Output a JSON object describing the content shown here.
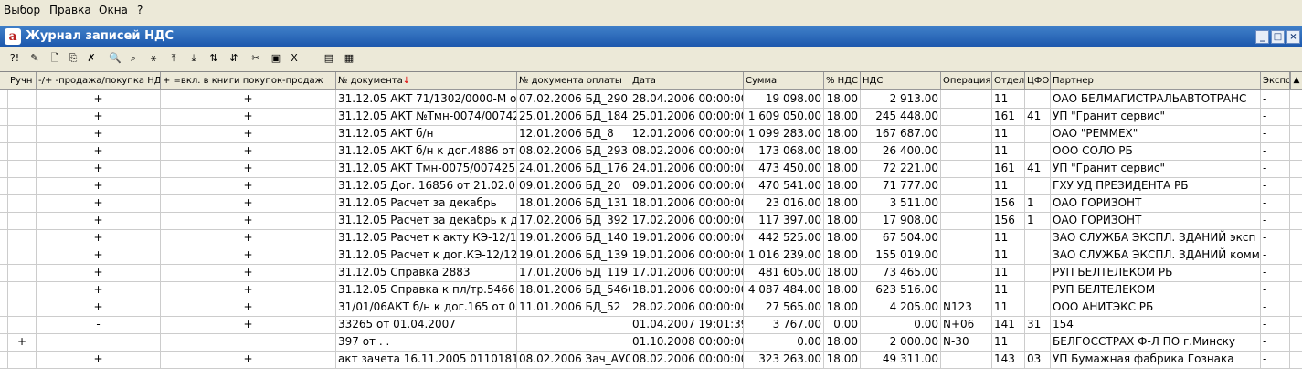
{
  "menu": [
    "Выбор",
    "Правка",
    "Окна",
    "?"
  ],
  "window": {
    "title": "Журнал записей НДС",
    "app_icon": "a",
    "minimize": "_",
    "maximize": "□",
    "close": "×"
  },
  "toolbar": [
    {
      "name": "help-icon",
      "glyph": "?!"
    },
    {
      "name": "edit-icon",
      "glyph": "✎"
    },
    {
      "name": "new-doc-icon",
      "glyph": "🗋"
    },
    {
      "name": "copy-icon",
      "glyph": "⎘"
    },
    {
      "name": "delete-doc-icon",
      "glyph": "✗"
    },
    {
      "name": "search-icon",
      "glyph": "🔍"
    },
    {
      "name": "find-doc-icon",
      "glyph": "⌕"
    },
    {
      "name": "filter-icon",
      "glyph": "⚹"
    },
    {
      "name": "move-up-icon",
      "glyph": "⤒"
    },
    {
      "name": "move-down-icon",
      "glyph": "⤓"
    },
    {
      "name": "sort-az-icon",
      "glyph": "⇅"
    },
    {
      "name": "sort-icon",
      "glyph": "⇵"
    },
    {
      "name": "cut-icon",
      "glyph": "✂"
    },
    {
      "name": "view-icon",
      "glyph": "▣"
    },
    {
      "name": "excel-icon",
      "glyph": "X"
    },
    {
      "name": "report-icon",
      "glyph": "▤"
    },
    {
      "name": "journal-icon",
      "glyph": "▦"
    }
  ],
  "columns": [
    {
      "id": "manual",
      "label": "Ручн"
    },
    {
      "id": "sale",
      "label": "-/+ -продажа/покупка НДС"
    },
    {
      "id": "book",
      "label": "+ =вкл. в книги покупок-продаж"
    },
    {
      "id": "docnum",
      "label": "№ документа"
    },
    {
      "id": "paydoc",
      "label": "№ документа оплаты"
    },
    {
      "id": "date",
      "label": "Дата"
    },
    {
      "id": "sum",
      "label": "Сумма"
    },
    {
      "id": "pct",
      "label": "% НДС"
    },
    {
      "id": "vat",
      "label": "НДС"
    },
    {
      "id": "op",
      "label": "Операция"
    },
    {
      "id": "dept",
      "label": "Отдел"
    },
    {
      "id": "cfo",
      "label": "ЦФО"
    },
    {
      "id": "partner",
      "label": "Партнер"
    },
    {
      "id": "export",
      "label": "Экспо"
    }
  ],
  "sort_indicator": "↓",
  "rows": [
    {
      "manual": "",
      "sale": "+",
      "book": "+",
      "docnum": "31.12.05 АКТ 71/1302/0000-М от",
      "paydoc": "07.02.2006 БД_290",
      "date": "28.04.2006 00:00:00",
      "sum": "19 098.00",
      "pct": "18.00",
      "vat": "2 913.00",
      "op": "",
      "dept": "11",
      "cfo": "",
      "partner": "ОАО БЕЛМАГИСТРАЛЬАВТОТРАНС",
      "export": "-"
    },
    {
      "manual": "",
      "sale": "+",
      "book": "+",
      "docnum": "31.12.05 АКТ №Тмн-0074/00742",
      "paydoc": "25.01.2006 БД_184",
      "date": "25.01.2006 00:00:00",
      "sum": "1 609 050.00",
      "pct": "18.00",
      "vat": "245 448.00",
      "op": "",
      "dept": "161",
      "cfo": "41",
      "partner": "УП \"Гранит сервис\"",
      "export": "-"
    },
    {
      "manual": "",
      "sale": "+",
      "book": "+",
      "docnum": "31.12.05 АКТ б/н",
      "paydoc": "12.01.2006 БД_8",
      "date": "12.01.2006 00:00:00",
      "sum": "1 099 283.00",
      "pct": "18.00",
      "vat": "167 687.00",
      "op": "",
      "dept": "11",
      "cfo": "",
      "partner": "ОАО \"РЕММЕХ\"",
      "export": "-"
    },
    {
      "manual": "",
      "sale": "+",
      "book": "+",
      "docnum": "31.12.05 АКТ б/н к дог.4886 от",
      "paydoc": "08.02.2006 БД_293",
      "date": "08.02.2006 00:00:00",
      "sum": "173 068.00",
      "pct": "18.00",
      "vat": "26 400.00",
      "op": "",
      "dept": "11",
      "cfo": "",
      "partner": "ООО СОЛО РБ",
      "export": "-"
    },
    {
      "manual": "",
      "sale": "+",
      "book": "+",
      "docnum": "31.12.05 АКТ Тмн-0075/0074253",
      "paydoc": "24.01.2006 БД_176",
      "date": "24.01.2006 00:00:00",
      "sum": "473 450.00",
      "pct": "18.00",
      "vat": "72 221.00",
      "op": "",
      "dept": "161",
      "cfo": "41",
      "partner": "УП \"Гранит сервис\"",
      "export": "-"
    },
    {
      "manual": "",
      "sale": "+",
      "book": "+",
      "docnum": "31.12.05 Дог. 16856 от 21.02.0",
      "paydoc": "09.01.2006 БД_20",
      "date": "09.01.2006 00:00:00",
      "sum": "470 541.00",
      "pct": "18.00",
      "vat": "71 777.00",
      "op": "",
      "dept": "11",
      "cfo": "",
      "partner": "ГХУ УД ПРЕЗИДЕНТА РБ",
      "export": "-"
    },
    {
      "manual": "",
      "sale": "+",
      "book": "+",
      "docnum": "31.12.05 Расчет за декабрь",
      "paydoc": "18.01.2006 БД_131",
      "date": "18.01.2006 00:00:00",
      "sum": "23 016.00",
      "pct": "18.00",
      "vat": "3 511.00",
      "op": "",
      "dept": "156",
      "cfo": "1",
      "partner": "ОАО ГОРИЗОНТ",
      "export": "-"
    },
    {
      "manual": "",
      "sale": "+",
      "book": "+",
      "docnum": "31.12.05 Расчет за декабрь к д",
      "paydoc": "17.02.2006 БД_392",
      "date": "17.02.2006 00:00:00",
      "sum": "117 397.00",
      "pct": "18.00",
      "vat": "17 908.00",
      "op": "",
      "dept": "156",
      "cfo": "1",
      "partner": "ОАО ГОРИЗОНТ",
      "export": "-"
    },
    {
      "manual": "",
      "sale": "+",
      "book": "+",
      "docnum": "31.12.05 Расчет к акту КЭ-12/1",
      "paydoc": "19.01.2006 БД_140",
      "date": "19.01.2006 00:00:00",
      "sum": "442 525.00",
      "pct": "18.00",
      "vat": "67 504.00",
      "op": "",
      "dept": "11",
      "cfo": "",
      "partner": "ЗАО СЛУЖБА ЭКСПЛ. ЗДАНИЙ эксп",
      "export": "-"
    },
    {
      "manual": "",
      "sale": "+",
      "book": "+",
      "docnum": "31.12.05 Расчет к дог.КЭ-12/12",
      "paydoc": "19.01.2006 БД_139",
      "date": "19.01.2006 00:00:00",
      "sum": "1 016 239.00",
      "pct": "18.00",
      "vat": "155 019.00",
      "op": "",
      "dept": "11",
      "cfo": "",
      "partner": "ЗАО СЛУЖБА ЭКСПЛ. ЗДАНИЙ комм",
      "export": "-"
    },
    {
      "manual": "",
      "sale": "+",
      "book": "+",
      "docnum": "31.12.05 Справка 2883",
      "paydoc": "17.01.2006 БД_119",
      "date": "17.01.2006 00:00:00",
      "sum": "481 605.00",
      "pct": "18.00",
      "vat": "73 465.00",
      "op": "",
      "dept": "11",
      "cfo": "",
      "partner": "РУП БЕЛТЕЛЕКОМ РБ",
      "export": "-"
    },
    {
      "manual": "",
      "sale": "+",
      "book": "+",
      "docnum": "31.12.05 Справка к пл/тр.5466",
      "paydoc": "18.01.2006 БД_5466",
      "date": "18.01.2006 00:00:00",
      "sum": "4 087 484.00",
      "pct": "18.00",
      "vat": "623 516.00",
      "op": "",
      "dept": "11",
      "cfo": "",
      "partner": "РУП БЕЛТЕЛЕКОМ",
      "export": "-"
    },
    {
      "manual": "",
      "sale": "+",
      "book": "+",
      "docnum": "31/01/06АКТ б/н к дог.165 от 0",
      "paydoc": "11.01.2006 БД_52",
      "date": "28.02.2006 00:00:00",
      "sum": "27 565.00",
      "pct": "18.00",
      "vat": "4 205.00",
      "op": "N123",
      "dept": "11",
      "cfo": "",
      "partner": "ООО АНИТЭКС РБ",
      "export": "-"
    },
    {
      "manual": "",
      "sale": "-",
      "book": "+",
      "docnum": "33265 от 01.04.2007",
      "paydoc": "",
      "date": "01.04.2007 19:01:39",
      "sum": "3 767.00",
      "pct": "0.00",
      "vat": "0.00",
      "op": "N+06",
      "dept": "141",
      "cfo": "31",
      "partner": "154",
      "export": "-"
    },
    {
      "manual": "+",
      "sale": "",
      "book": "",
      "docnum": "397 от   .  .",
      "paydoc": "",
      "date": "01.10.2008 00:00:00",
      "sum": "0.00",
      "pct": "18.00",
      "vat": "2 000.00",
      "op": "N-30",
      "dept": "11",
      "cfo": "",
      "partner": "БЕЛГОССТРАХ Ф-Л ПО г.Минску",
      "export": "-"
    },
    {
      "manual": "",
      "sale": "+",
      "book": "+",
      "docnum": "акт зачета 16.11.2005 0110181",
      "paydoc": "08.02.2006 Зач_АУ0",
      "date": "08.02.2006 00:00:00",
      "sum": "323 263.00",
      "pct": "18.00",
      "vat": "49 311.00",
      "op": "",
      "dept": "143",
      "cfo": "03",
      "partner": "УП Бумажная фабрика Гознака",
      "export": "-"
    }
  ]
}
